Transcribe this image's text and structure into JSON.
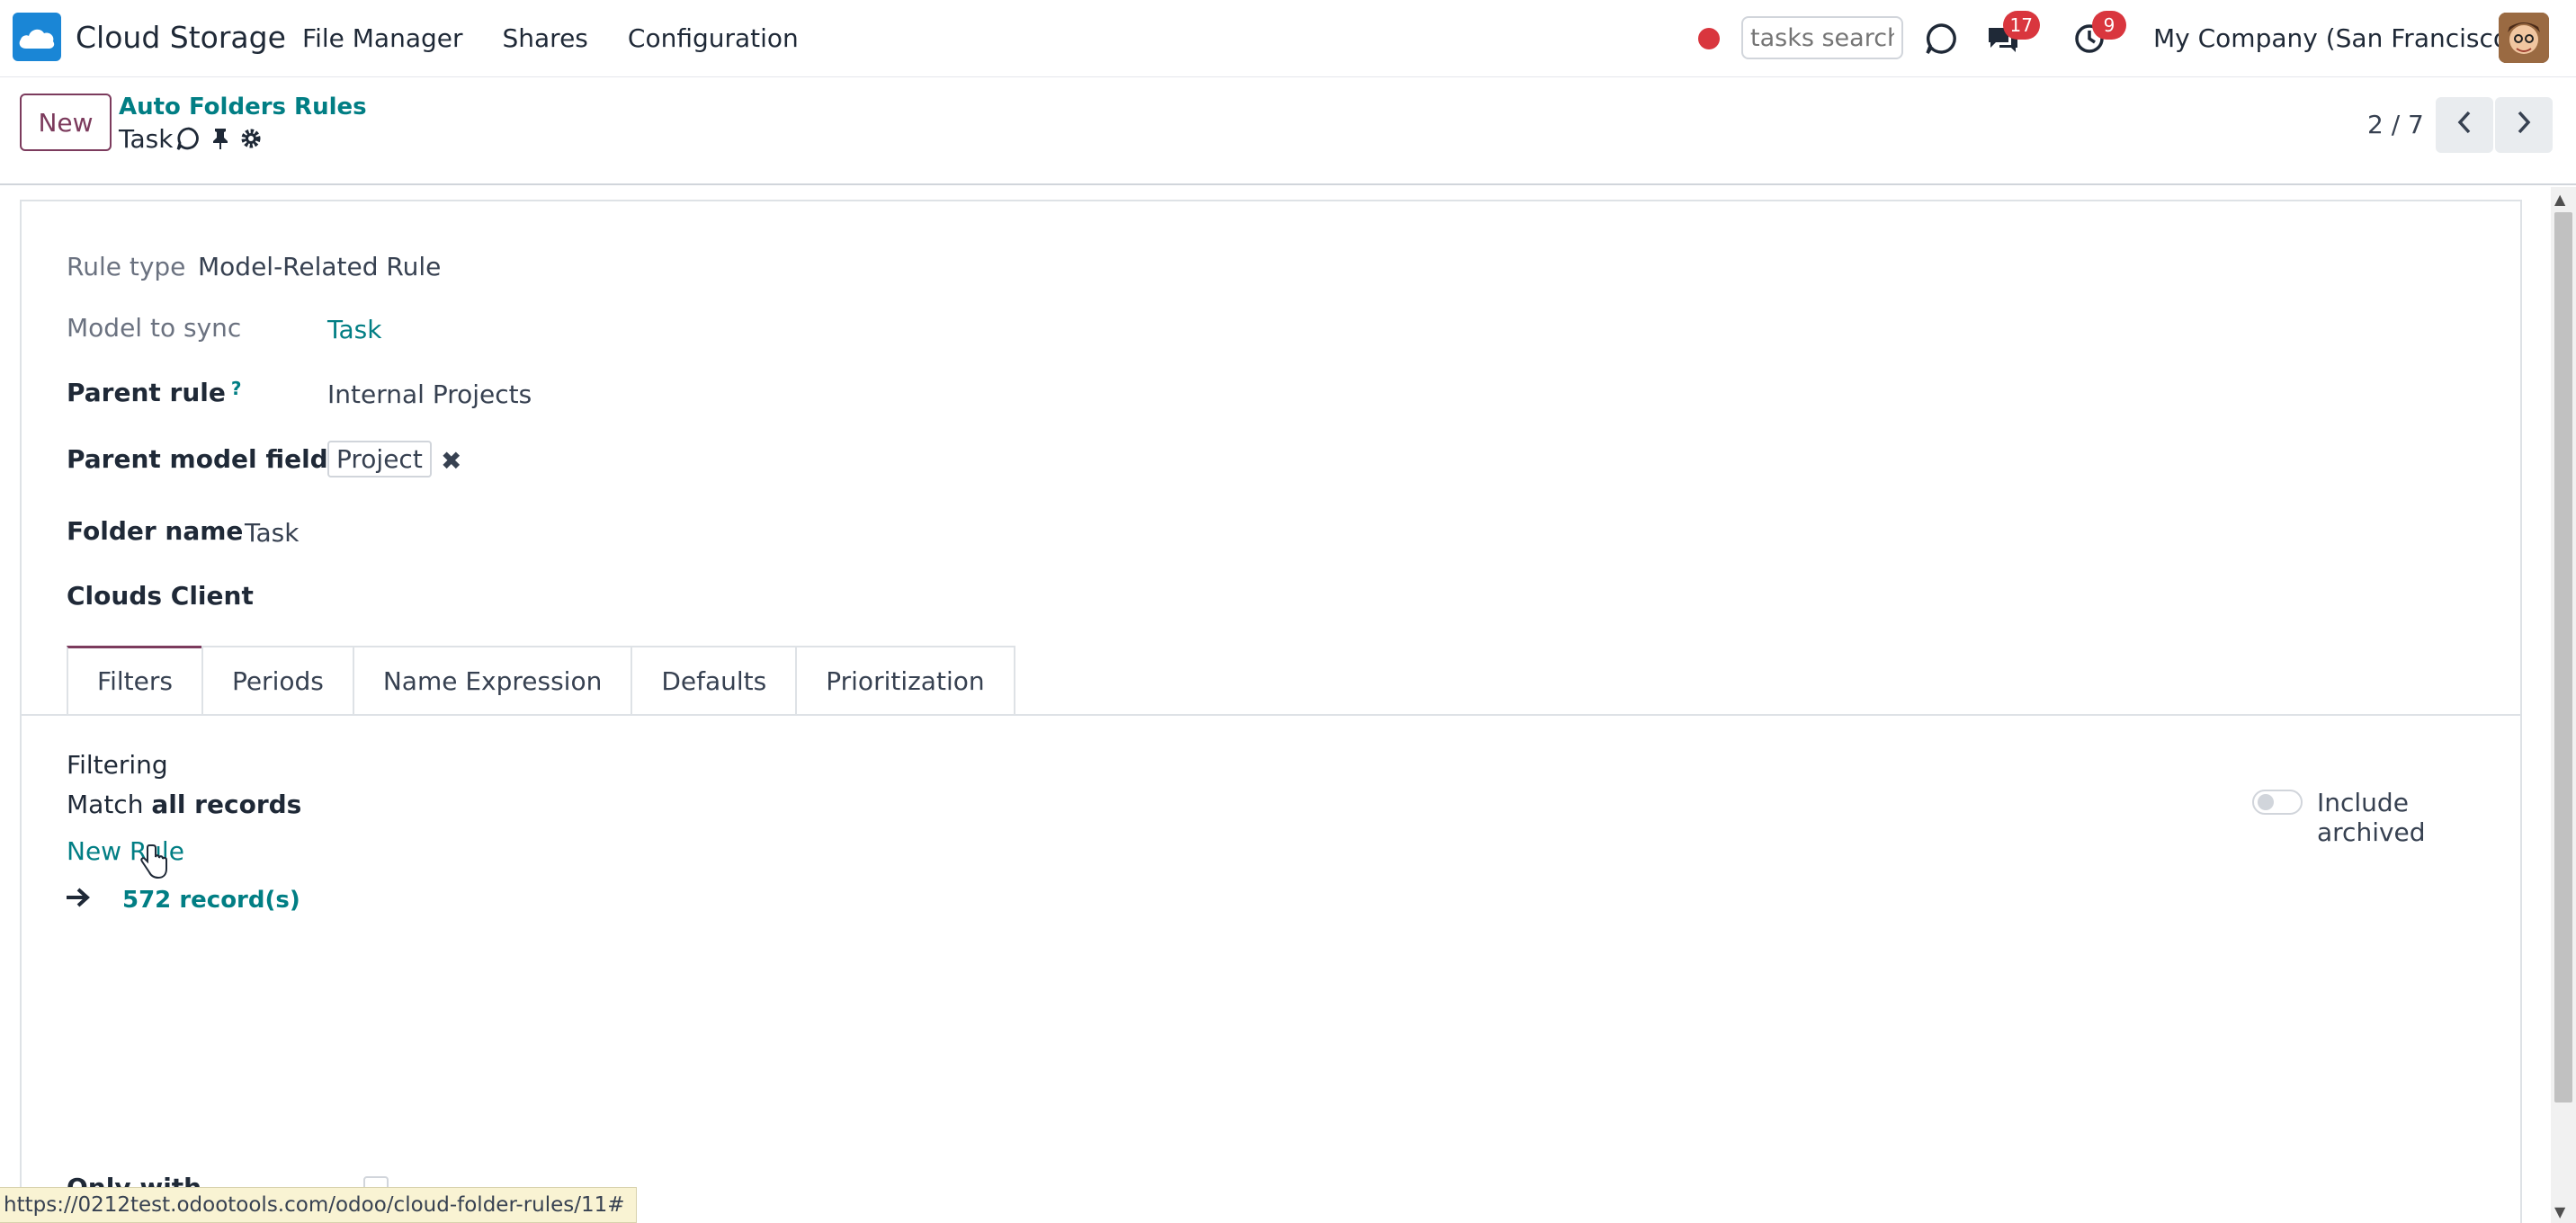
{
  "app": {
    "name": "Cloud Storage",
    "brand_color": "#1a86d6",
    "accent_color": "#7c3b5d",
    "link_color": "#017e84"
  },
  "nav": {
    "menu": [
      "File Manager",
      "Shares",
      "Configuration"
    ],
    "search_placeholder": "tasks search",
    "messages_count": "17",
    "activities_count": "9",
    "company": "My Company (San Francisco)"
  },
  "control": {
    "new_label": "New",
    "breadcrumb_parent": "Auto Folders Rules",
    "record_title": "Task",
    "pager": "2 / 7"
  },
  "form": {
    "rule_type": {
      "label": "Rule type",
      "value": "Model-Related Rule"
    },
    "model_to_sync": {
      "label": "Model to sync",
      "value": "Task"
    },
    "parent_rule": {
      "label": "Parent rule",
      "help": "?",
      "value": "Internal Projects"
    },
    "parent_model_field": {
      "label": "Parent model field",
      "help": "?",
      "value": "Project"
    },
    "folder_name": {
      "label": "Folder name",
      "value": "Task"
    },
    "clouds_client": {
      "label": "Clouds Client"
    }
  },
  "tabs": [
    "Filters",
    "Periods",
    "Name Expression",
    "Defaults",
    "Prioritization"
  ],
  "filters": {
    "heading": "Filtering",
    "match_prefix": "Match",
    "match_value": "all records",
    "new_rule": "New Rule",
    "records": "572 record(s)",
    "include_archived": "Include archived",
    "include_archived_on": false,
    "partial_label": "Only with"
  },
  "status_url": "https://0212test.odootools.com/odoo/cloud-folder-rules/11#"
}
